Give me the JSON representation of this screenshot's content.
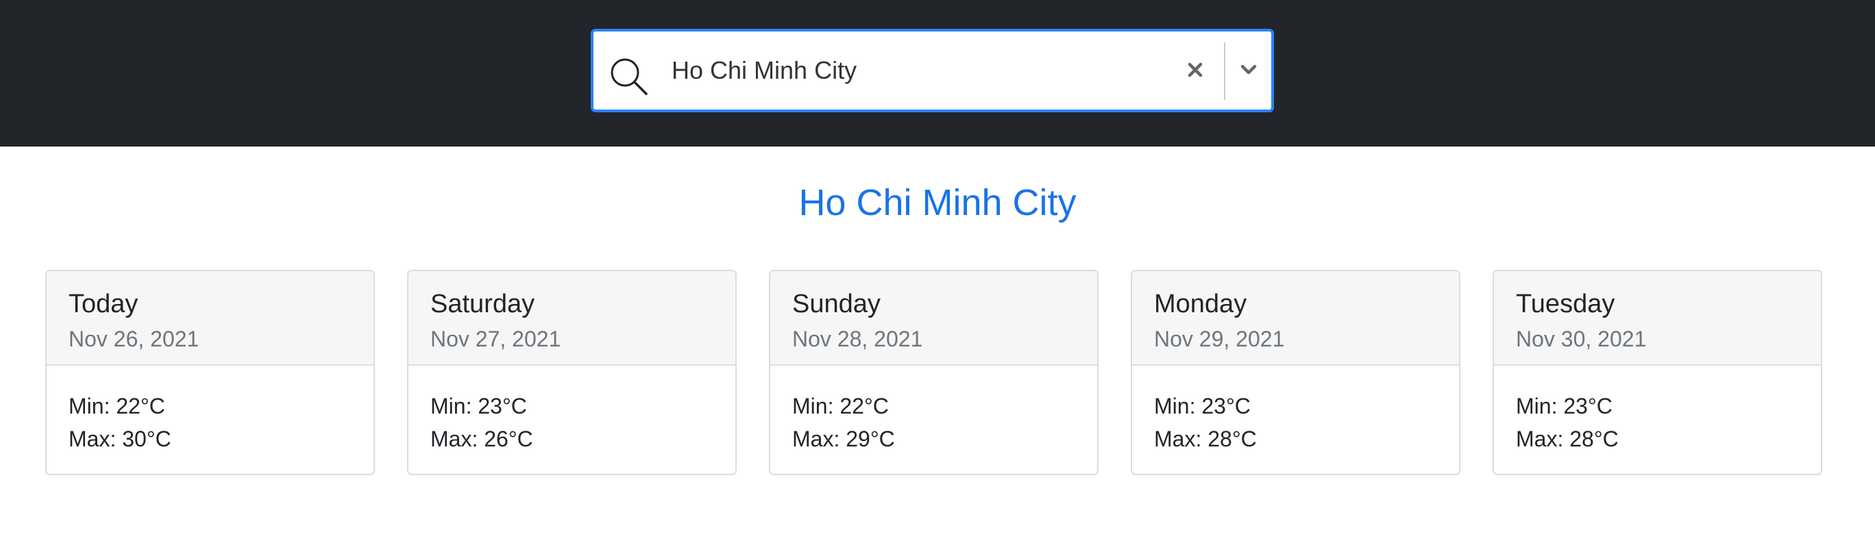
{
  "search": {
    "value": "Ho Chi Minh City",
    "icon": "search-icon",
    "clear_icon": "close-icon",
    "dropdown_icon": "chevron-down-icon",
    "focus_border_color": "#2684ff"
  },
  "city": {
    "title": "Ho Chi Minh City",
    "color": "#1a73e8"
  },
  "forecast": [
    {
      "day": "Today",
      "date": "Nov 26, 2021",
      "min": "Min: 22°C",
      "max": "Max: 30°C"
    },
    {
      "day": "Saturday",
      "date": "Nov 27, 2021",
      "min": "Min: 23°C",
      "max": "Max: 26°C"
    },
    {
      "day": "Sunday",
      "date": "Nov 28, 2021",
      "min": "Min: 22°C",
      "max": "Max: 29°C"
    },
    {
      "day": "Monday",
      "date": "Nov 29, 2021",
      "min": "Min: 23°C",
      "max": "Max: 28°C"
    },
    {
      "day": "Tuesday",
      "date": "Nov 30, 2021",
      "min": "Min: 23°C",
      "max": "Max: 28°C"
    }
  ],
  "colors": {
    "header_background": "#212529",
    "card_header_background": "#f6f6f6",
    "muted_text": "#6c757d"
  }
}
